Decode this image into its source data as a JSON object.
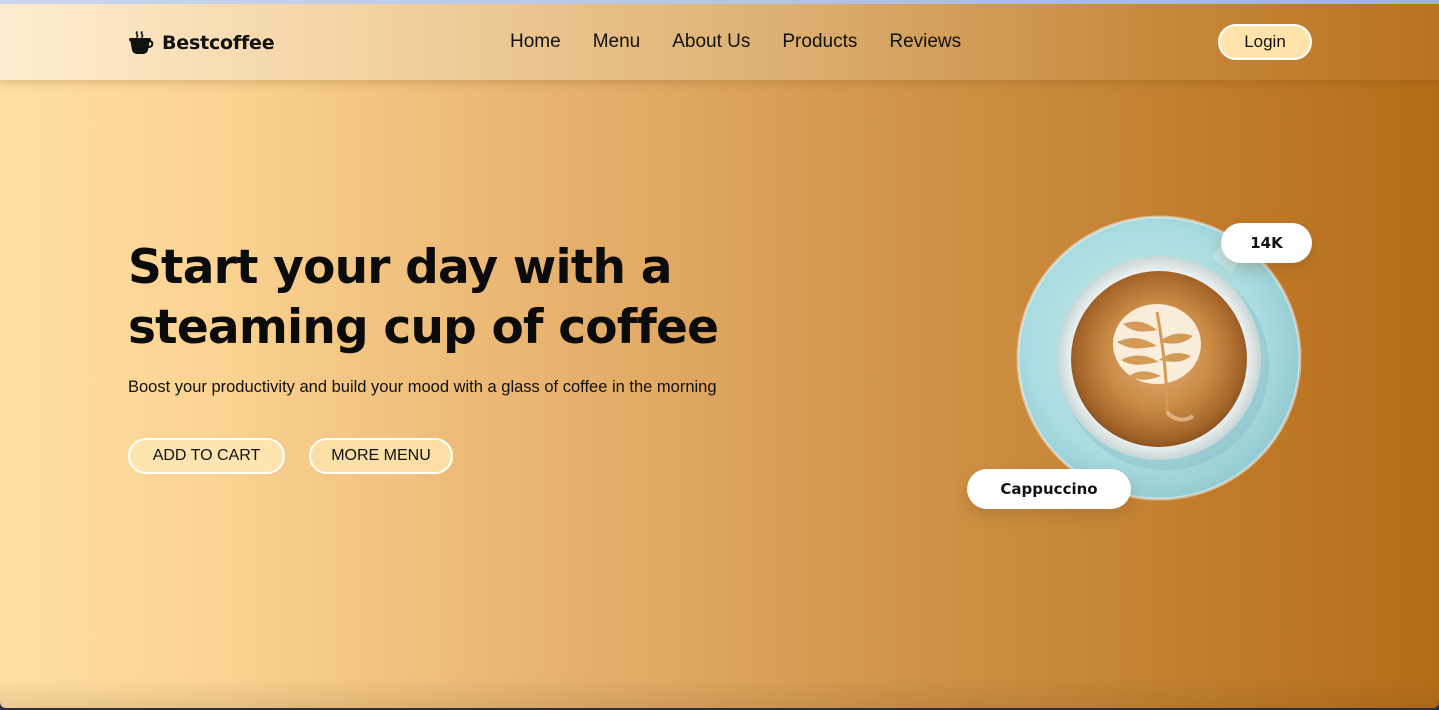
{
  "brand": {
    "name": "Bestcoffee",
    "icon": "coffee-cup-icon"
  },
  "nav": {
    "items": [
      {
        "label": "Home"
      },
      {
        "label": "Menu"
      },
      {
        "label": "About Us"
      },
      {
        "label": "Products"
      },
      {
        "label": "Reviews"
      }
    ],
    "login_label": "Login"
  },
  "hero": {
    "title_line1": "Start your day with a",
    "title_line2": "steaming cup of coffee",
    "subtitle": "Boost your productivity and build your mood with a glass of coffee in the morning",
    "add_to_cart_label": "ADD TO CART",
    "more_menu_label": "MORE MENU"
  },
  "product": {
    "image": "cappuccino-latte-art-image",
    "count_badge": "14K",
    "name_badge": "Cappuccino"
  },
  "colors": {
    "gradient_start": "#ffdfa3",
    "gradient_end": "#b56c18",
    "button_fill": "#fde4ad",
    "text": "#111111"
  }
}
